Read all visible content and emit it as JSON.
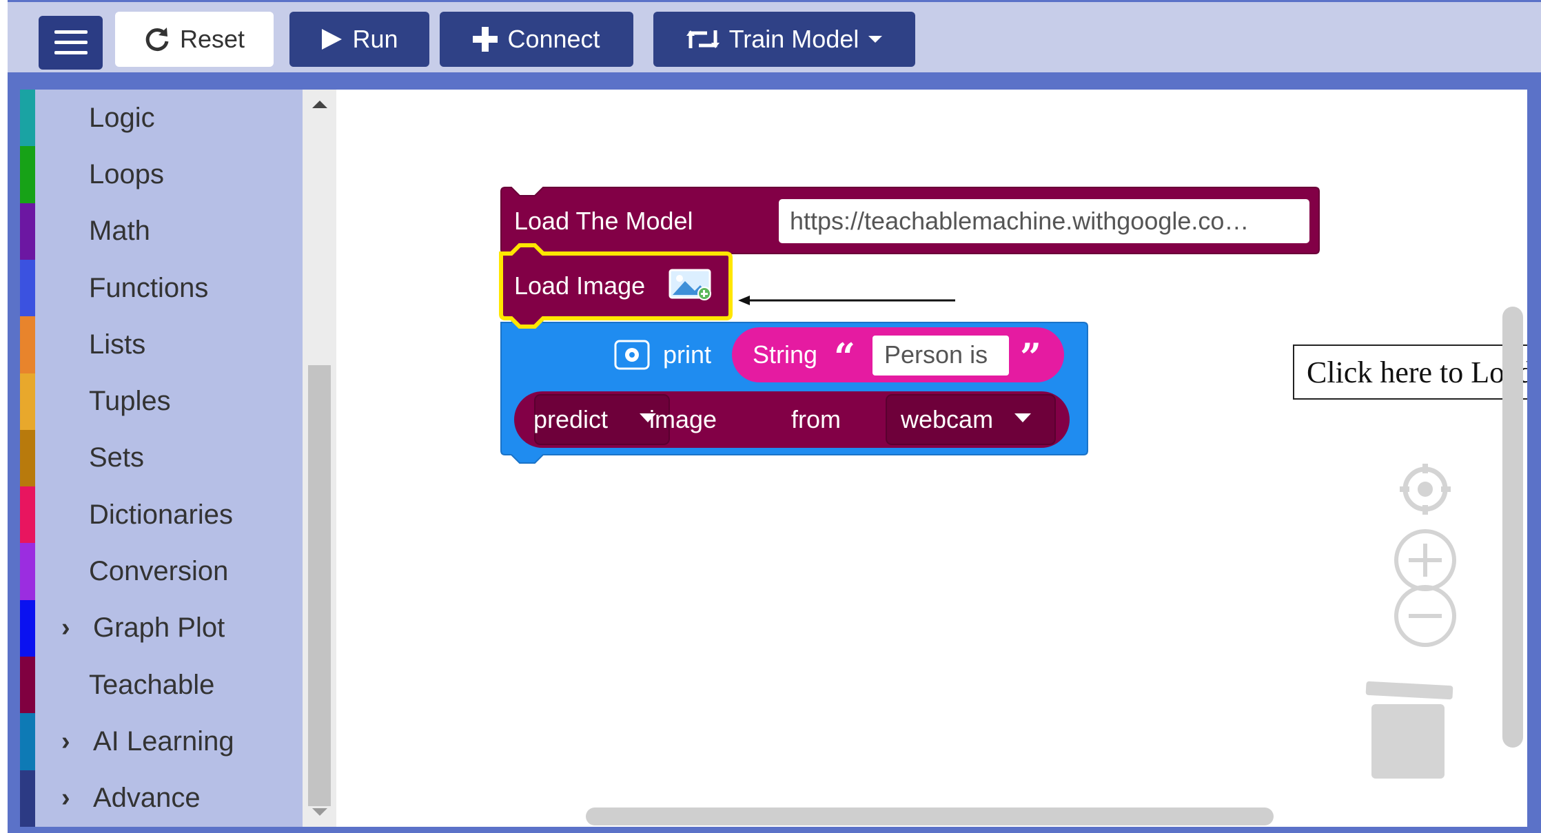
{
  "toolbar": {
    "menu_icon": "hamburger-icon",
    "reset_label": "Reset",
    "run_label": "Run",
    "connect_label": "Connect",
    "train_label": "Train Model"
  },
  "sidebar": {
    "categories": [
      {
        "label": "Logic",
        "color": "#1aa3a3",
        "expandable": false
      },
      {
        "label": "Loops",
        "color": "#17a217",
        "expandable": false
      },
      {
        "label": "Math",
        "color": "#6c17a2",
        "expandable": false
      },
      {
        "label": "Functions",
        "color": "#3b52e0",
        "expandable": false
      },
      {
        "label": "Lists",
        "color": "#e8842c",
        "expandable": false
      },
      {
        "label": "Tuples",
        "color": "#e8a82c",
        "expandable": false
      },
      {
        "label": "Sets",
        "color": "#b87a0c",
        "expandable": false
      },
      {
        "label": "Dictionaries",
        "color": "#e8155f",
        "expandable": false
      },
      {
        "label": "Conversion",
        "color": "#9b2de0",
        "expandable": false
      },
      {
        "label": "Graph Plot",
        "color": "#0a12f0",
        "expandable": true
      },
      {
        "label": "Teachable",
        "color": "#800040",
        "expandable": true
      },
      {
        "label": "AI Learning",
        "color": "#0e7ab5",
        "expandable": true
      },
      {
        "label": "Advance",
        "color": "#2c3a84",
        "expandable": true
      }
    ]
  },
  "workspace": {
    "load_model_label": "Load The Model",
    "load_model_url": "https://teachablemachine.withgoogle.co…",
    "load_image_label": "Load Image",
    "print_label": "print",
    "string_label": "String",
    "string_value": "Person is",
    "open_quote": "“",
    "close_quote": "”",
    "predict_label": "predict",
    "predict_source": "image",
    "from_label": "from",
    "device_value": "webcam",
    "callout_text": "Click here to Load Image"
  },
  "colors": {
    "teachable_block": "#820046",
    "print_block": "#1f8cf0",
    "string_block": "#e51ba1",
    "highlight": "#ffe600",
    "toolbar_button": "#2f4186"
  },
  "controls": {
    "recenter_icon": "target-icon",
    "zoom_in_icon": "zoom-in-icon",
    "zoom_out_icon": "zoom-out-icon",
    "trash_icon": "trash-icon"
  }
}
